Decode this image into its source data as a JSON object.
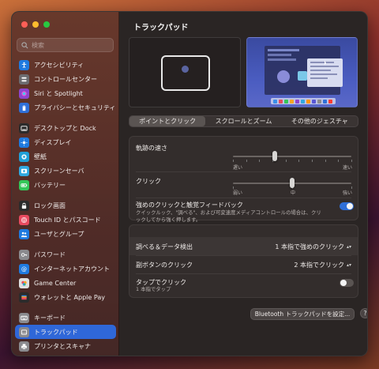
{
  "search": {
    "placeholder": "検索"
  },
  "sidebar": {
    "groups": [
      [
        {
          "label": "アクセシビリティ",
          "icon": "accessibility-icon",
          "color": "#1f7ae0"
        },
        {
          "label": "コントロールセンター",
          "icon": "control-center-icon",
          "color": "#6c6c70"
        },
        {
          "label": "Siri と Spotlight",
          "icon": "siri-icon",
          "color": "#8e44d0"
        },
        {
          "label": "プライバシーとセキュリティ",
          "icon": "hand-icon",
          "color": "#2f6fd8"
        }
      ],
      [
        {
          "label": "デスクトップと Dock",
          "icon": "dock-icon",
          "color": "#2b2b2b"
        },
        {
          "label": "ディスプレイ",
          "icon": "display-icon",
          "color": "#1f7ae0"
        },
        {
          "label": "壁紙",
          "icon": "wallpaper-icon",
          "color": "#20a0d8"
        },
        {
          "label": "スクリーンセーバ",
          "icon": "screensaver-icon",
          "color": "#30a8e0"
        },
        {
          "label": "バッテリー",
          "icon": "battery-icon",
          "color": "#34c759"
        }
      ],
      [
        {
          "label": "ロック画面",
          "icon": "lock-screen-icon",
          "color": "#2b2b2b"
        },
        {
          "label": "Touch ID とパスコード",
          "icon": "fingerprint-icon",
          "color": "#e84a5f"
        },
        {
          "label": "ユーザとグループ",
          "icon": "users-icon",
          "color": "#1f7ae0"
        }
      ],
      [
        {
          "label": "パスワード",
          "icon": "key-icon",
          "color": "#8a8a8e"
        },
        {
          "label": "インターネットアカウント",
          "icon": "at-icon",
          "color": "#1f7ae0"
        },
        {
          "label": "Game Center",
          "icon": "game-center-icon",
          "color": "#e0e0e0"
        },
        {
          "label": "ウォレットと Apple Pay",
          "icon": "wallet-icon",
          "color": "#2b2b2b"
        }
      ],
      [
        {
          "label": "キーボード",
          "icon": "keyboard-icon",
          "color": "#8a8a8e"
        },
        {
          "label": "トラックパッド",
          "icon": "trackpad-icon",
          "color": "#8a8a8e",
          "active": true
        },
        {
          "label": "プリンタとスキャナ",
          "icon": "printer-icon",
          "color": "#8a8a8e"
        }
      ]
    ]
  },
  "main": {
    "title": "トラックパッド",
    "tabs": [
      "ポイントとクリック",
      "スクロールとズーム",
      "その他のジェスチャ"
    ],
    "tracking_speed": {
      "label": "軌跡の速さ",
      "min_label": "遅い",
      "max_label": "速い",
      "value": 0.35
    },
    "click": {
      "label": "クリック",
      "min_label": "弱い",
      "mid_label": "中",
      "max_label": "強い",
      "value": 0.5
    },
    "force_click": {
      "label": "強めのクリックと触覚フィードバック",
      "description": "クイックルック、\"調べる\"、および可変速度メディアコントロールの場合は、クリックしてから強く押します。",
      "enabled": true
    },
    "lookup": {
      "label": "調べる＆データ検出",
      "value": "1 本指で強めのクリック"
    },
    "secondary_click": {
      "label": "副ボタンのクリック",
      "value": "2 本指でクリック"
    },
    "tap_to_click": {
      "label": "タップでクリック",
      "sublabel": "1 本指でタップ",
      "enabled": false
    },
    "bluetooth_button": "Bluetooth トラックパッドを設定...",
    "help_label": "?"
  }
}
